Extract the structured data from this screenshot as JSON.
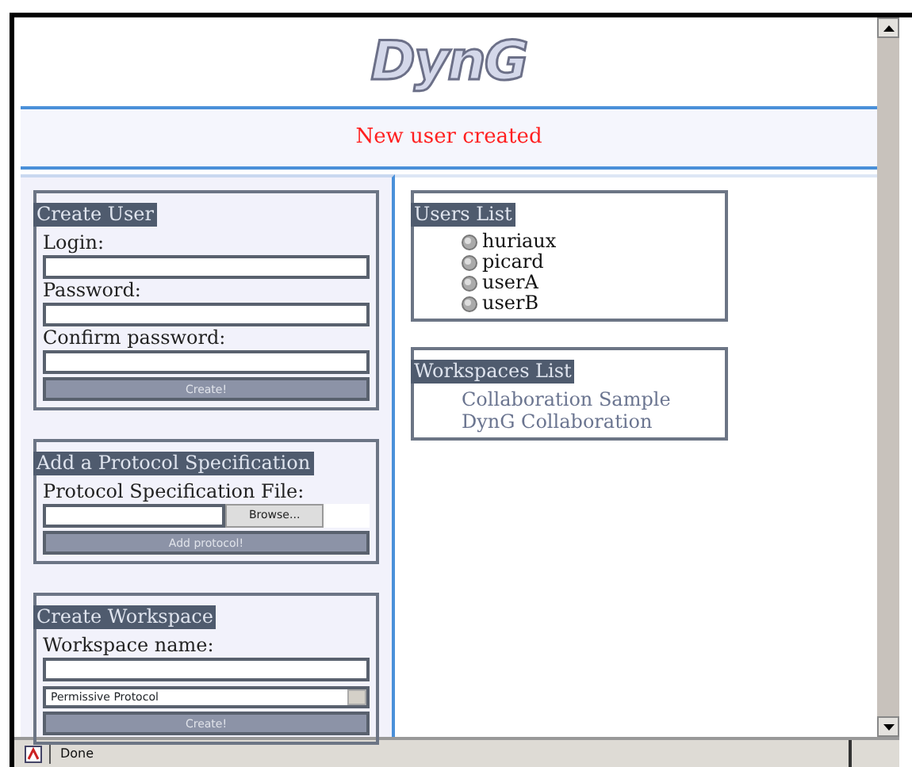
{
  "logo": {
    "text": "DynG"
  },
  "message": "New user created",
  "create_user": {
    "title": "Create User",
    "fields": [
      {
        "label": "Login:"
      },
      {
        "label": "Password:"
      },
      {
        "label": "Confirm password:"
      }
    ],
    "button": "Create!"
  },
  "add_protocol": {
    "title": "Add a Protocol Specification",
    "file_label": "Protocol Specification File:",
    "browse": "Browse...",
    "button": "Add protocol!"
  },
  "create_workspace": {
    "title": "Create Workspace",
    "field_label": "Workspace name:",
    "protocol_select": "Permissive Protocol",
    "button": "Create!"
  },
  "users_list": {
    "title": "Users List",
    "users": [
      "huriaux",
      "picard",
      "userA",
      "userB"
    ]
  },
  "workspaces_list": {
    "title": "Workspaces List",
    "workspaces": [
      "Collaboration Sample",
      "DynG Collaboration"
    ]
  },
  "status_bar": {
    "text": "Done"
  }
}
